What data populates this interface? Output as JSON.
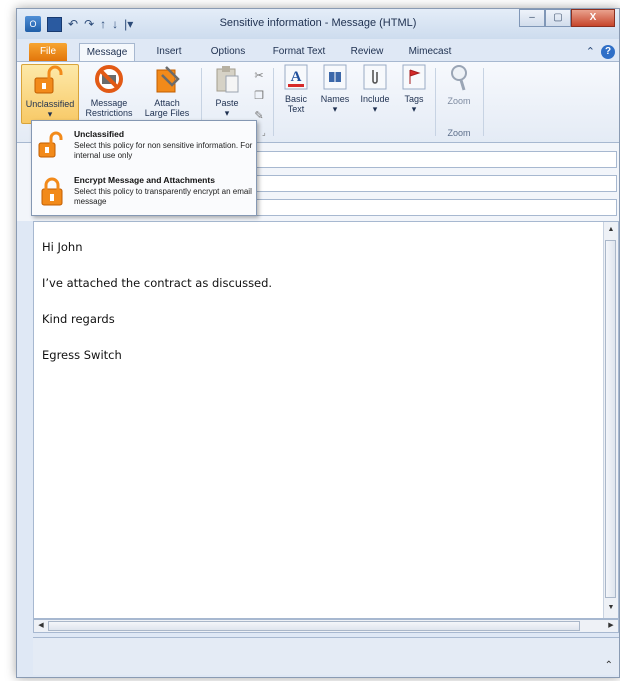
{
  "window": {
    "title": "Sensitive information - Message (HTML)",
    "minimize": "–",
    "maximize": "▢",
    "close": "X"
  },
  "tabs": [
    "File",
    "Message",
    "Insert",
    "Options",
    "Format Text",
    "Review",
    "Mimecast"
  ],
  "ribbon": {
    "unclassified": "Unclassified",
    "message_restrictions_line1": "Message",
    "message_restrictions_line2": "Restrictions",
    "attach_line1": "Attach",
    "attach_line2": "Large Files",
    "paste": "Paste",
    "basic_text_line1": "Basic",
    "basic_text_line2": "Text",
    "names": "Names",
    "include": "Include",
    "tags": "Tags",
    "zoom": "Zoom",
    "zoom_group": "Zoom"
  },
  "dropdown": {
    "items": [
      {
        "title": "Unclassified",
        "desc": "Select this policy for non sensitive information.  For internal use only"
      },
      {
        "title": "Encrypt Message and Attachments",
        "desc": "Select this policy to transparently encrypt an email message"
      }
    ]
  },
  "body": {
    "lines": [
      "Hi John",
      "I’ve attached the contract as discussed.",
      "Kind regards",
      "Egress Switch"
    ]
  },
  "colors": {
    "accent": "#f28a1a",
    "ribbon": "#e4ebf5",
    "file_tab": "#e2750a"
  }
}
